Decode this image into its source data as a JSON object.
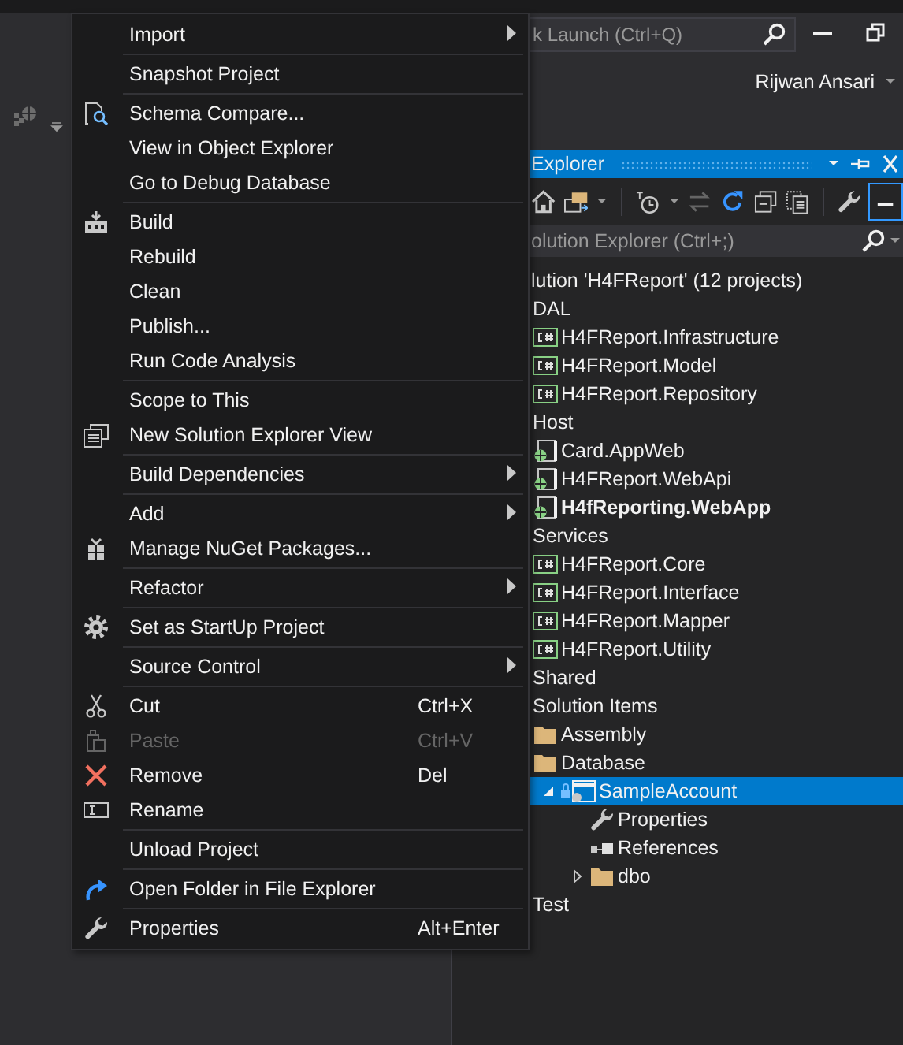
{
  "title_bar": {
    "quick_launch": {
      "placeholder": "k Launch (Ctrl+Q)"
    },
    "user": "Rijwan Ansari"
  },
  "context_menu": {
    "groups": [
      [
        {
          "label": "Import",
          "submenu": true,
          "disabled": false
        }
      ],
      [
        {
          "label": "Snapshot Project",
          "disabled": false
        }
      ],
      [
        {
          "label": "Schema Compare...",
          "disabled": false
        },
        {
          "label": "View in Object Explorer",
          "disabled": false
        },
        {
          "label": "Go to Debug Database",
          "disabled": false
        }
      ],
      [
        {
          "label": "Build",
          "disabled": false
        },
        {
          "label": "Rebuild",
          "disabled": false
        },
        {
          "label": "Clean",
          "disabled": false
        },
        {
          "label": "Publish...",
          "disabled": false
        },
        {
          "label": "Run Code Analysis",
          "disabled": false
        }
      ],
      [
        {
          "label": "Scope to This",
          "disabled": false
        },
        {
          "label": "New Solution Explorer View",
          "disabled": false
        }
      ],
      [
        {
          "label": "Build Dependencies",
          "submenu": true,
          "disabled": false
        }
      ],
      [
        {
          "label": "Add",
          "submenu": true,
          "disabled": false
        },
        {
          "label": "Manage NuGet Packages...",
          "disabled": false
        }
      ],
      [
        {
          "label": "Refactor",
          "submenu": true,
          "disabled": false
        }
      ],
      [
        {
          "label": "Set as StartUp Project",
          "disabled": false
        }
      ],
      [
        {
          "label": "Source Control",
          "submenu": true,
          "disabled": false
        }
      ],
      [
        {
          "label": "Cut",
          "shortcut": "Ctrl+X",
          "disabled": false
        },
        {
          "label": "Paste",
          "shortcut": "Ctrl+V",
          "disabled": true
        },
        {
          "label": "Remove",
          "shortcut": "Del",
          "disabled": false
        },
        {
          "label": "Rename",
          "disabled": false
        }
      ],
      [
        {
          "label": "Unload Project",
          "disabled": false
        }
      ],
      [
        {
          "label": "Open Folder in File Explorer",
          "disabled": false
        }
      ],
      [
        {
          "label": "Properties",
          "shortcut": "Alt+Enter",
          "disabled": false
        }
      ]
    ]
  },
  "solution_explorer": {
    "title": "Explorer",
    "toolbar": [
      {
        "dropdown": false,
        "disabled": false,
        "selected": false
      },
      {
        "dropdown": true,
        "disabled": false,
        "selected": false
      },
      {
        "dropdown": true,
        "disabled": false,
        "selected": false
      },
      {
        "dropdown": false,
        "disabled": true,
        "selected": false
      },
      {
        "dropdown": false,
        "disabled": false,
        "selected": false
      },
      {
        "dropdown": false,
        "disabled": false,
        "selected": false
      },
      {
        "dropdown": false,
        "disabled": false,
        "selected": false
      },
      {
        "dropdown": false,
        "disabled": false,
        "selected": false
      },
      {
        "dropdown": false,
        "disabled": false,
        "selected": true
      }
    ],
    "search": {
      "placeholder": "olution Explorer (Ctrl+;)"
    },
    "solution": {
      "label": "lution 'H4FReport' (12 projects)",
      "selected": false
    },
    "items": [
      {
        "label": "DAL",
        "selected": false,
        "startup": false,
        "children": [
          {
            "label": "H4FReport.Infrastructure",
            "kind": "library",
            "selected": false,
            "startup": false
          },
          {
            "label": "H4FReport.Model",
            "kind": "library",
            "selected": false,
            "startup": false
          },
          {
            "label": "H4FReport.Repository",
            "kind": "library",
            "selected": false,
            "startup": false
          }
        ]
      },
      {
        "label": "Host",
        "selected": false,
        "startup": false,
        "children": [
          {
            "label": "Card.AppWeb",
            "kind": "web",
            "selected": false,
            "startup": false
          },
          {
            "label": "H4FReport.WebApi",
            "kind": "web",
            "selected": false,
            "startup": false
          },
          {
            "label": "H4fReporting.WebApp",
            "kind": "web",
            "selected": false,
            "startup": true
          }
        ]
      },
      {
        "label": "Services",
        "selected": false,
        "startup": false,
        "children": [
          {
            "label": "H4FReport.Core",
            "kind": "library",
            "selected": false,
            "startup": false
          },
          {
            "label": "H4FReport.Interface",
            "kind": "library",
            "selected": false,
            "startup": false
          },
          {
            "label": "H4FReport.Mapper",
            "kind": "library",
            "selected": false,
            "startup": false
          },
          {
            "label": "H4FReport.Utility",
            "kind": "library",
            "selected": false,
            "startup": false
          }
        ]
      },
      {
        "label": "Shared",
        "selected": false,
        "startup": false
      },
      {
        "label": "Solution Items",
        "selected": false,
        "startup": false,
        "children": [
          {
            "label": "Assembly",
            "kind": "folder",
            "selected": false,
            "startup": false
          },
          {
            "label": "Database",
            "kind": "folder",
            "selected": false,
            "startup": false,
            "children": [
              {
                "label": "SampleAccount",
                "kind": "database",
                "expanded": true,
                "selected": true,
                "startup": false,
                "children": [
                  {
                    "label": "Properties",
                    "kind": "properties",
                    "selected": false,
                    "startup": false
                  },
                  {
                    "label": "References",
                    "kind": "references",
                    "selected": false,
                    "startup": false
                  },
                  {
                    "label": "dbo",
                    "kind": "folder",
                    "expanded": false,
                    "selected": false,
                    "startup": false
                  }
                ]
              }
            ]
          }
        ]
      },
      {
        "label": "Test",
        "selected": false,
        "startup": false
      }
    ]
  }
}
